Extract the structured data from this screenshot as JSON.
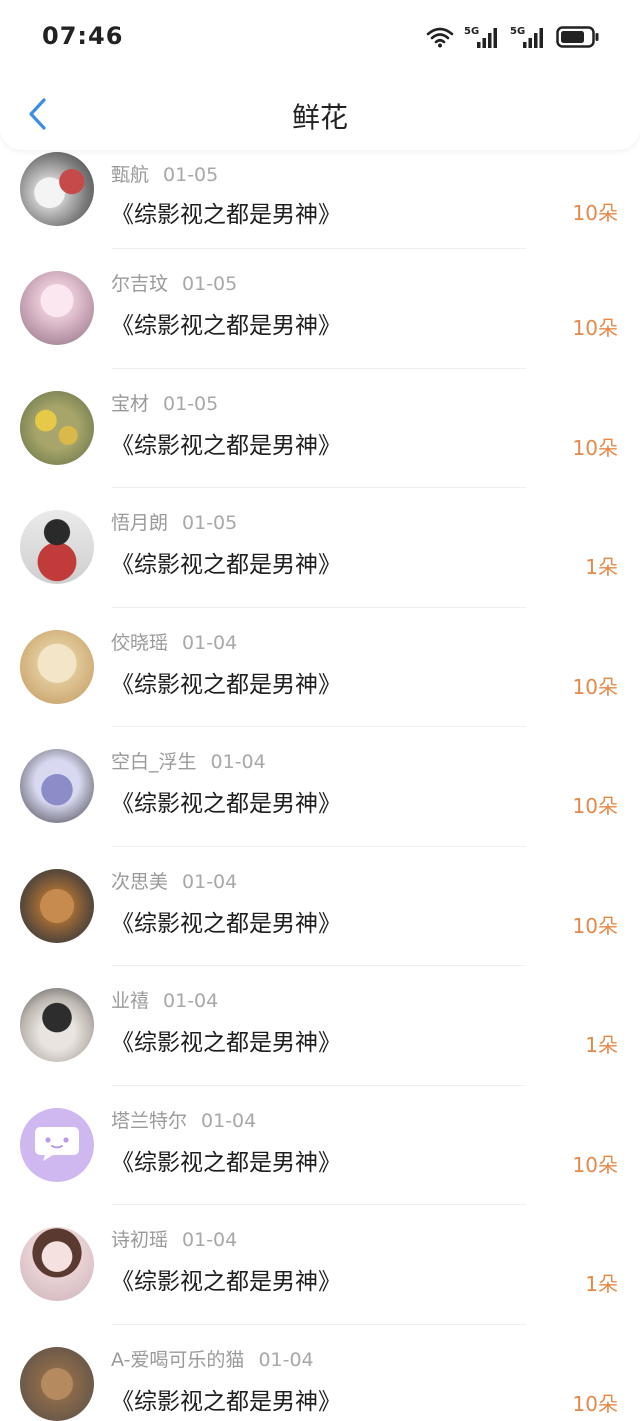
{
  "status_bar": {
    "time": "07:46",
    "icons": [
      "wifi-icon",
      "signal-5g-icon",
      "signal-5g-icon",
      "battery-icon"
    ],
    "network_label": "5G"
  },
  "header": {
    "title": "鲜花",
    "back_icon": "chevron-left-icon",
    "back_color": "#3b8ee8"
  },
  "colors": {
    "count": "#e5894a",
    "meta": "#9a9a9a",
    "divider": "#efefef"
  },
  "list": {
    "items": [
      {
        "name": "甄航",
        "date": "01-05",
        "book": "《综影视之都是男神》",
        "count": "10朵"
      },
      {
        "name": "尔吉玟",
        "date": "01-05",
        "book": "《综影视之都是男神》",
        "count": "10朵"
      },
      {
        "name": "宝材",
        "date": "01-05",
        "book": "《综影视之都是男神》",
        "count": "10朵"
      },
      {
        "name": "悟月朗",
        "date": "01-05",
        "book": "《综影视之都是男神》",
        "count": "1朵"
      },
      {
        "name": "佼晓瑶",
        "date": "01-04",
        "book": "《综影视之都是男神》",
        "count": "10朵"
      },
      {
        "name": "空白_浮生",
        "date": "01-04",
        "book": "《综影视之都是男神》",
        "count": "10朵"
      },
      {
        "name": "次思美",
        "date": "01-04",
        "book": "《综影视之都是男神》",
        "count": "10朵"
      },
      {
        "name": "业禧",
        "date": "01-04",
        "book": "《综影视之都是男神》",
        "count": "1朵"
      },
      {
        "name": "塔兰特尔",
        "date": "01-04",
        "book": "《综影视之都是男神》",
        "count": "10朵"
      },
      {
        "name": "诗初瑶",
        "date": "01-04",
        "book": "《综影视之都是男神》",
        "count": "1朵"
      },
      {
        "name": "A-爱喝可乐的猫",
        "date": "01-04",
        "book": "《综影视之都是男神》",
        "count": "10朵"
      }
    ]
  }
}
